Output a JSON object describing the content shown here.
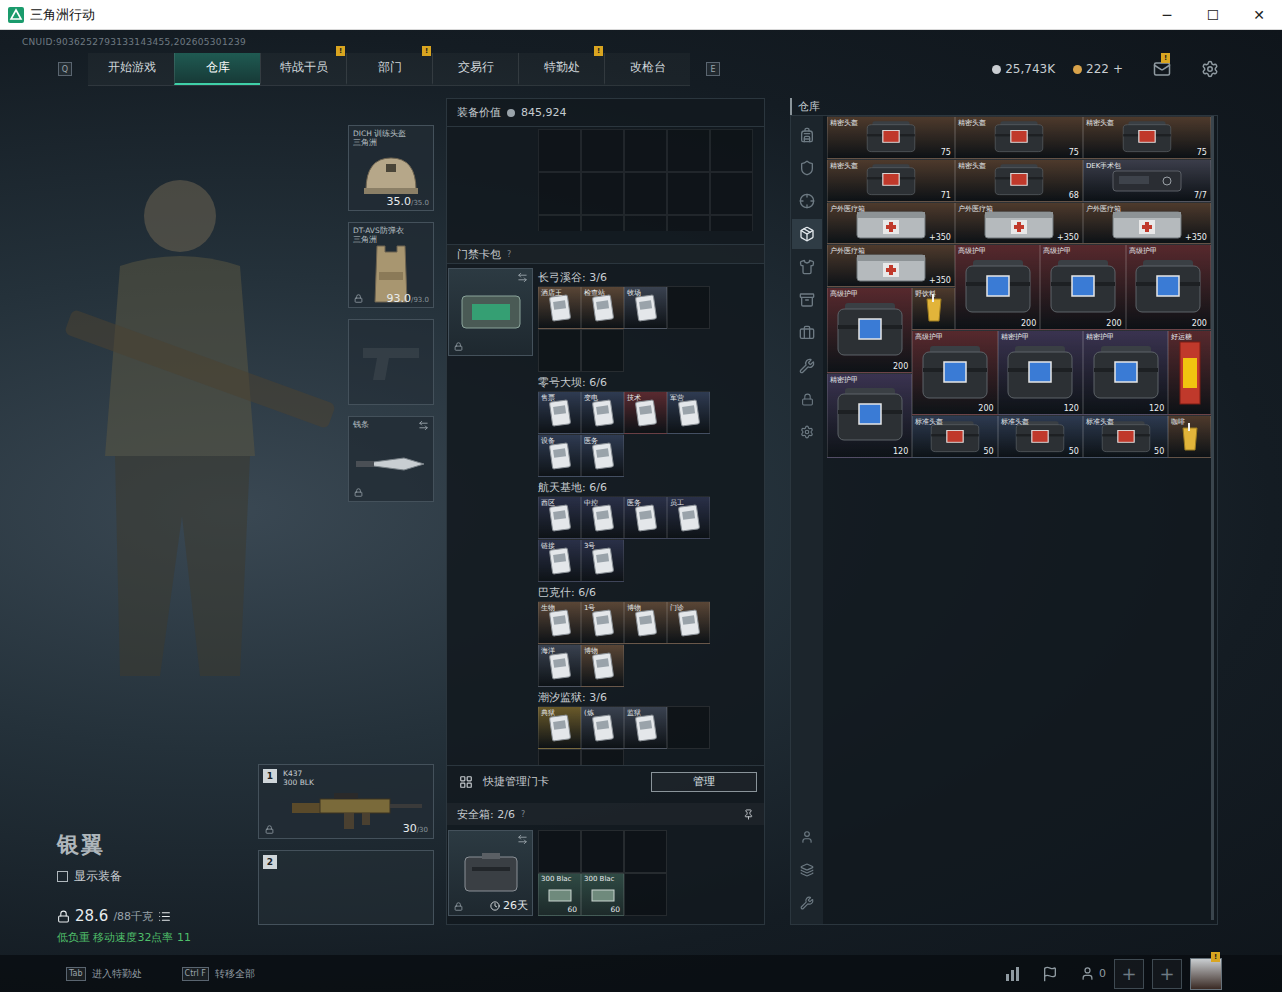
{
  "window": {
    "title": "三角洲行动",
    "controls": [
      "─",
      "☐",
      "✕"
    ]
  },
  "uid": "CNUID:9036252793133143455,202605301239",
  "nav": {
    "left_key": "Q",
    "right_key": "E",
    "tabs": [
      {
        "label": "开始游戏",
        "selected": false,
        "badge": ""
      },
      {
        "label": "仓库",
        "selected": true,
        "badge": ""
      },
      {
        "label": "特战干员",
        "selected": false,
        "badge": "!"
      },
      {
        "label": "部门",
        "selected": false,
        "badge": "!"
      },
      {
        "label": "交易行",
        "selected": false,
        "badge": ""
      },
      {
        "label": "特勤处",
        "selected": false,
        "badge": "!"
      },
      {
        "label": "改枪台",
        "selected": false,
        "badge": ""
      }
    ],
    "currencies": [
      {
        "value": "25,743K",
        "color": "#c9cdd2",
        "plus": ""
      },
      {
        "value": "222",
        "color": "#d8a24a",
        "plus": "+"
      }
    ],
    "mail_badge": "!"
  },
  "loadout": {
    "slots": [
      {
        "kind": "helmet",
        "name": "DICH 训练头盔",
        "sub": "三角洲",
        "value": "35.0",
        "max": "/35.0",
        "locked": false,
        "swap": false
      },
      {
        "kind": "armor",
        "name": "DT-AVS防弹衣",
        "sub": "三角洲",
        "value": "93.0",
        "max": "/93.0",
        "locked": true,
        "swap": false
      },
      {
        "kind": "pistol",
        "name": "",
        "sub": "",
        "value": "",
        "max": "",
        "locked": false,
        "swap": false
      },
      {
        "kind": "melee",
        "name": "钱条",
        "sub": "",
        "value": "",
        "max": "",
        "locked": true,
        "swap": true
      }
    ],
    "weapons": [
      {
        "number": "1",
        "name": "K437",
        "ammo": "300 BLK",
        "count": "30",
        "max": "/30",
        "empty": false,
        "locked": true
      },
      {
        "number": "2",
        "name": "",
        "ammo": "",
        "count": "",
        "max": "",
        "empty": true,
        "locked": false
      }
    ]
  },
  "operator": {
    "name": "银翼",
    "show_gear": {
      "label": "显示装备",
      "checked": false
    },
    "weight": "28.6",
    "weight_max": "/88千克",
    "status": "低负重 移动速度32点率 11"
  },
  "equipment_value": {
    "label": "装备价值",
    "value": "845,924"
  },
  "keycards": {
    "title": "门禁卡包",
    "help": "?",
    "sections": [
      {
        "name": "长弓溪谷: 3/6",
        "slots": 6,
        "cards": [
          {
            "label": "酒店王",
            "color": "#5a4636"
          },
          {
            "label": "检查站",
            "color": "#5a4636"
          },
          {
            "label": "牧场",
            "color": "#3a4250"
          }
        ]
      },
      {
        "name": "零号大坝: 6/6",
        "slots": 6,
        "cards": [
          {
            "label": "售票",
            "color": "#2f3b52"
          },
          {
            "label": "变电",
            "color": "#2f3b52"
          },
          {
            "label": "技术",
            "color": "#5a2a30"
          },
          {
            "label": "军营",
            "color": "#2f3b52"
          },
          {
            "label": "设备",
            "color": "#2f3b52"
          },
          {
            "label": "医务",
            "color": "#2f3b52"
          }
        ]
      },
      {
        "name": "航天基地: 6/6",
        "slots": 6,
        "cards": [
          {
            "label": "西区",
            "color": "#2a3048"
          },
          {
            "label": "中控",
            "color": "#2a3048"
          },
          {
            "label": "医务",
            "color": "#2a3048"
          },
          {
            "label": "员工",
            "color": "#2a3048"
          },
          {
            "label": "链接",
            "color": "#2a3048"
          },
          {
            "label": "3号",
            "color": "#2a3048"
          }
        ]
      },
      {
        "name": "巴克什: 6/6",
        "slots": 6,
        "cards": [
          {
            "label": "生物",
            "color": "#5a4636"
          },
          {
            "label": "1号",
            "color": "#5a4636"
          },
          {
            "label": "博物",
            "color": "#5a4636"
          },
          {
            "label": "门诊",
            "color": "#5a4636"
          },
          {
            "label": "海洋",
            "color": "#3a4250"
          },
          {
            "label": "博物",
            "color": "#5a4636"
          }
        ]
      },
      {
        "name": "潮汐监狱: 3/6",
        "slots": 6,
        "cards": [
          {
            "label": "典狱",
            "color": "#6a5a2a"
          },
          {
            "label": "(炼",
            "color": "#3a4250"
          },
          {
            "label": "监狱",
            "color": "#3a4250"
          }
        ]
      }
    ]
  },
  "quick_manage": {
    "label": "快捷管理门卡",
    "button": "管理"
  },
  "safe_box": {
    "title": "安全箱: 2/6",
    "help": "?",
    "timer": "26天",
    "slots": 6,
    "items": [
      {
        "name": "300 Blac",
        "count": "60"
      },
      {
        "name": "300 Blac",
        "count": "60"
      }
    ]
  },
  "warehouse": {
    "title": "仓库",
    "tabs": [
      {
        "selected": false
      },
      {
        "selected": false
      },
      {
        "selected": false
      },
      {
        "selected": true
      },
      {
        "selected": false
      },
      {
        "selected": false
      },
      {
        "selected": false
      },
      {
        "selected": false
      }
    ],
    "items": [
      {
        "kind": "helmet_case",
        "label": "精密头盔",
        "value": "75",
        "color": "#4e3a2c"
      },
      {
        "kind": "helmet_case",
        "label": "精密头盔",
        "value": "75",
        "color": "#4e3a2c"
      },
      {
        "kind": "helmet_case",
        "label": "精密头盔",
        "value": "75",
        "color": "#4e3a2c"
      },
      {
        "kind": "helmet_case",
        "label": "精密头盔",
        "value": "71",
        "color": "#4e3a2c"
      },
      {
        "kind": "helmet_case",
        "label": "精密头盔",
        "value": "68",
        "color": "#4e3a2c"
      },
      {
        "kind": "tool_case",
        "label": "DEK手术包",
        "value": "7/7",
        "color": "#3b3d4a"
      },
      {
        "kind": "med_case",
        "label": "户外医疗箱",
        "value": "+350",
        "color": "#4e3a2c"
      },
      {
        "kind": "med_case",
        "label": "户外医疗箱",
        "value": "+350",
        "color": "#4e3a2c"
      },
      {
        "kind": "med_case",
        "label": "户外医疗箱",
        "value": "+350",
        "color": "#4e3a2c"
      },
      {
        "kind": "med_case",
        "label": "户外医疗箱",
        "value": "+350",
        "color": "#4e3a2c"
      },
      {
        "kind": "armor_case",
        "label": "高级护甲",
        "value": "200",
        "color": "#57292d"
      },
      {
        "kind": "armor_case",
        "label": "高级护甲",
        "value": "200",
        "color": "#57292d"
      },
      {
        "kind": "armor_case",
        "label": "高级护甲",
        "value": "200",
        "color": "#57292d"
      },
      {
        "kind": "armor_case",
        "label": "高级护甲",
        "value": "200",
        "color": "#57292d"
      },
      {
        "kind": "drink",
        "label": "野饮料",
        "value": "",
        "color": "#4e3a2c"
      },
      {
        "kind": "armor_case",
        "label": "高级护甲",
        "value": "200",
        "color": "#57292d"
      },
      {
        "kind": "armor_case",
        "label": "精密护甲",
        "value": "120",
        "color": "#3a3350"
      },
      {
        "kind": "armor_case",
        "label": "精密护甲",
        "value": "120",
        "color": "#3a3350"
      },
      {
        "kind": "snack",
        "label": "好运糖",
        "value": "",
        "color": "#57292d"
      },
      {
        "kind": "armor_case",
        "label": "精密护甲",
        "value": "120",
        "color": "#3a3350"
      },
      {
        "kind": "standard_helmet",
        "label": "标准头盔",
        "value": "50",
        "color": "#2d3a50"
      },
      {
        "kind": "standard_helmet",
        "label": "标准头盔",
        "value": "50",
        "color": "#2d3a50"
      },
      {
        "kind": "standard_helmet",
        "label": "标准头盔",
        "value": "50",
        "color": "#2d3a50"
      },
      {
        "kind": "drink",
        "label": "咖啡",
        "value": "",
        "color": "#4e3a2c"
      }
    ]
  },
  "bottom_bar": {
    "hints": [
      {
        "key": "Tab",
        "label": "进入特勤处"
      },
      {
        "key": "Ctrl F",
        "label": "转移全部"
      }
    ],
    "friends": "0",
    "add_slots": [
      "+",
      "+"
    ],
    "avatar_badge": "!"
  }
}
